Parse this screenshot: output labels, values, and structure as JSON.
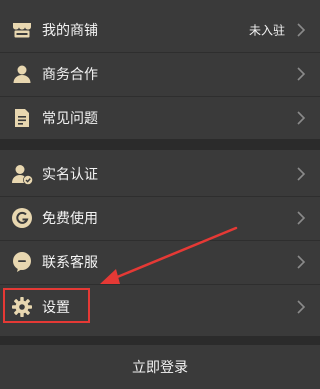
{
  "menu_group_1": [
    {
      "label": "我的商铺",
      "value": "未入驻",
      "icon": "shop-icon"
    },
    {
      "label": "商务合作",
      "icon": "person-icon"
    },
    {
      "label": "常见问题",
      "icon": "document-icon"
    }
  ],
  "menu_group_2": [
    {
      "label": "实名认证",
      "icon": "verified-user-icon"
    },
    {
      "label": "免费使用",
      "icon": "g-circle-icon"
    },
    {
      "label": "联系客服",
      "icon": "chat-bubble-icon"
    },
    {
      "label": "设置",
      "icon": "gear-icon"
    }
  ],
  "login_button": "立即登录",
  "colors": {
    "background": "#2b2b2b",
    "panel": "#3a3a3a",
    "icon": "#e8d7b0",
    "annotation": "#e53935"
  }
}
